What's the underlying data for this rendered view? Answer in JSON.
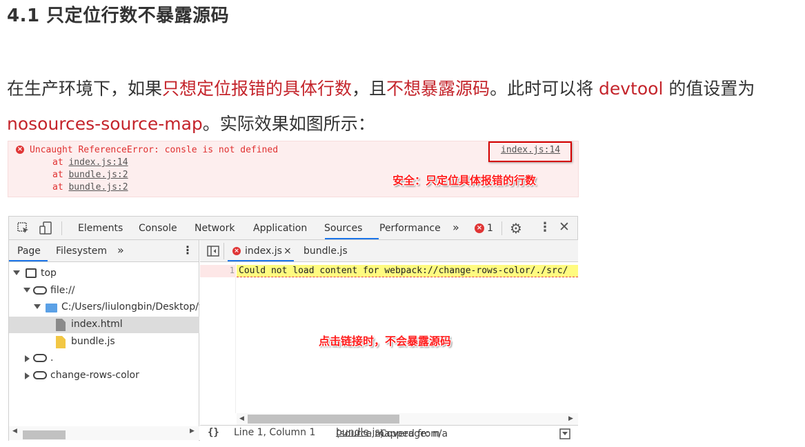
{
  "heading": "4.1 只定位行数不暴露源码",
  "paragraph": {
    "t1": "在生产环境下，如果",
    "r1": "只想定位报错的具体行数",
    "t2": "，且",
    "r2": "不想暴露源码",
    "t3": "。此时可以将 ",
    "r3": "devtool",
    "t4": " 的值设置为",
    "r4": "nosources-source-map",
    "t5": "。实际效果如图所示："
  },
  "console": {
    "error_message": "Uncaught ReferenceError: consle is not defined",
    "error_link": "index.js:14",
    "stack": [
      {
        "prefix": "at ",
        "link": "index.js:14"
      },
      {
        "prefix": "at ",
        "link": "bundle.js:2"
      },
      {
        "prefix": "at ",
        "link": "bundle.js:2"
      }
    ],
    "callout": "安全：只定位具体报错的行数"
  },
  "devtools": {
    "tabs": [
      "Elements",
      "Console",
      "Network",
      "Application",
      "Sources",
      "Performance"
    ],
    "active_tab": "Sources",
    "more_tabs": "»",
    "error_count": "1",
    "left_tabs": [
      "Page",
      "Filesystem"
    ],
    "left_more": "»",
    "tree": [
      {
        "label": "top",
        "icon": "frame-icon"
      },
      {
        "label": "file://",
        "icon": "cloud-icon"
      },
      {
        "label": "C:/Users/liulongbin/Desktop/vu",
        "icon": "folder-icon"
      },
      {
        "label": "index.html",
        "icon": "html-file-icon"
      },
      {
        "label": "bundle.js",
        "icon": "js-file-icon"
      },
      {
        "label": ".",
        "icon": "cloud-icon"
      },
      {
        "label": "change-rows-color",
        "icon": "cloud-icon"
      }
    ],
    "editor_tabs": [
      "index.js",
      "bundle.js"
    ],
    "line_number": "1",
    "code": "Could not load content for webpack://change-rows-color/./src/",
    "callout": "点击链接时，不会暴露源码",
    "status": {
      "braces": "{}",
      "position": "Line 1, Column 1",
      "mapped_prefix": "(source mapped from ",
      "mapped_link": "bundle.js",
      "mapped_suffix": ")",
      "coverage": "Coverage: n/a"
    }
  },
  "colors": {
    "accent_red": "#c4242b",
    "error_red": "#e03030",
    "tab_blue": "#1a73e8"
  }
}
